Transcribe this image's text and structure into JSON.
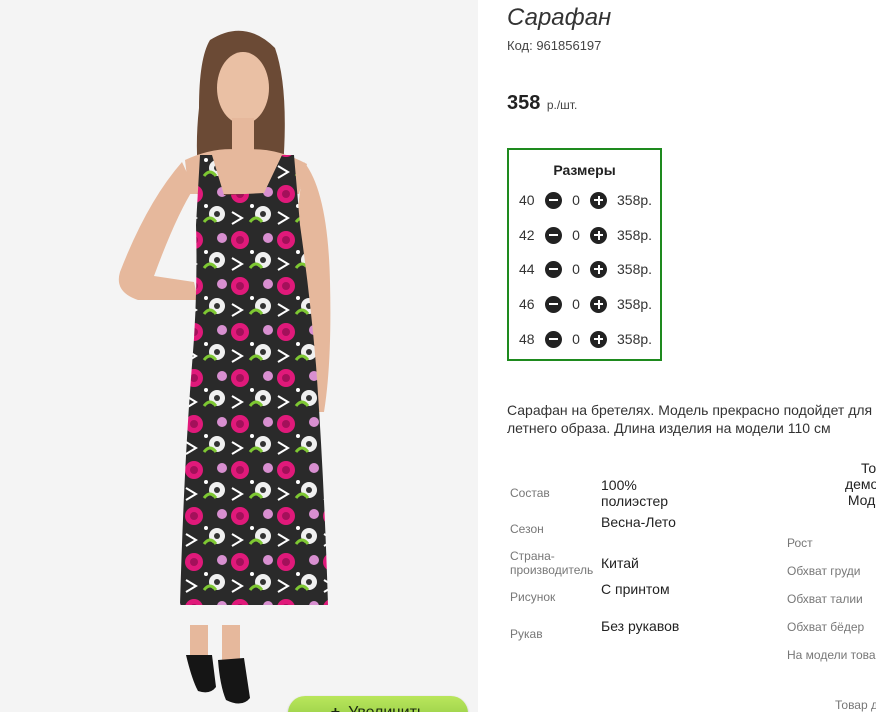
{
  "product": {
    "title": "Сарафан",
    "code": "Код: 961856197",
    "price_value": "358",
    "price_unit": "р./шт."
  },
  "photo": {
    "zoom_button_label": "Увеличить",
    "zoom_plus": "+"
  },
  "sizes": {
    "title": "Размеры",
    "rows": [
      {
        "size": "40",
        "qty": "0",
        "price": "358р."
      },
      {
        "size": "42",
        "qty": "0",
        "price": "358р."
      },
      {
        "size": "44",
        "qty": "0",
        "price": "358р."
      },
      {
        "size": "46",
        "qty": "0",
        "price": "358р."
      },
      {
        "size": "48",
        "qty": "0",
        "price": "358р."
      }
    ]
  },
  "description": {
    "line1": "Сарафан на бретелях. Модель прекрасно подойдет для",
    "line2": "летнего образа. Длина изделия на модели 110 см"
  },
  "properties": [
    {
      "label": "Состав",
      "value": "100% полиэстер"
    },
    {
      "label": "Сезон",
      "value": "Весна-Лето"
    },
    {
      "label": "Страна-производитель",
      "value": "Китай"
    },
    {
      "label": "Рисунок",
      "value": "С принтом"
    },
    {
      "label": "Рукав",
      "value": "Без рукавов"
    }
  ],
  "model": {
    "head_line1": "Товар",
    "head_line2": "демонстри",
    "head_line3": "Модель N",
    "measurements": [
      "Рост",
      "Обхват груди",
      "Обхват талии",
      "Обхват бёдер",
      "На модели това"
    ],
    "footer": "Товар д"
  },
  "colors": {
    "accent_green": "#1e8a1e",
    "button_green": "#8cc63f",
    "dress_pink": "#e0197a"
  }
}
